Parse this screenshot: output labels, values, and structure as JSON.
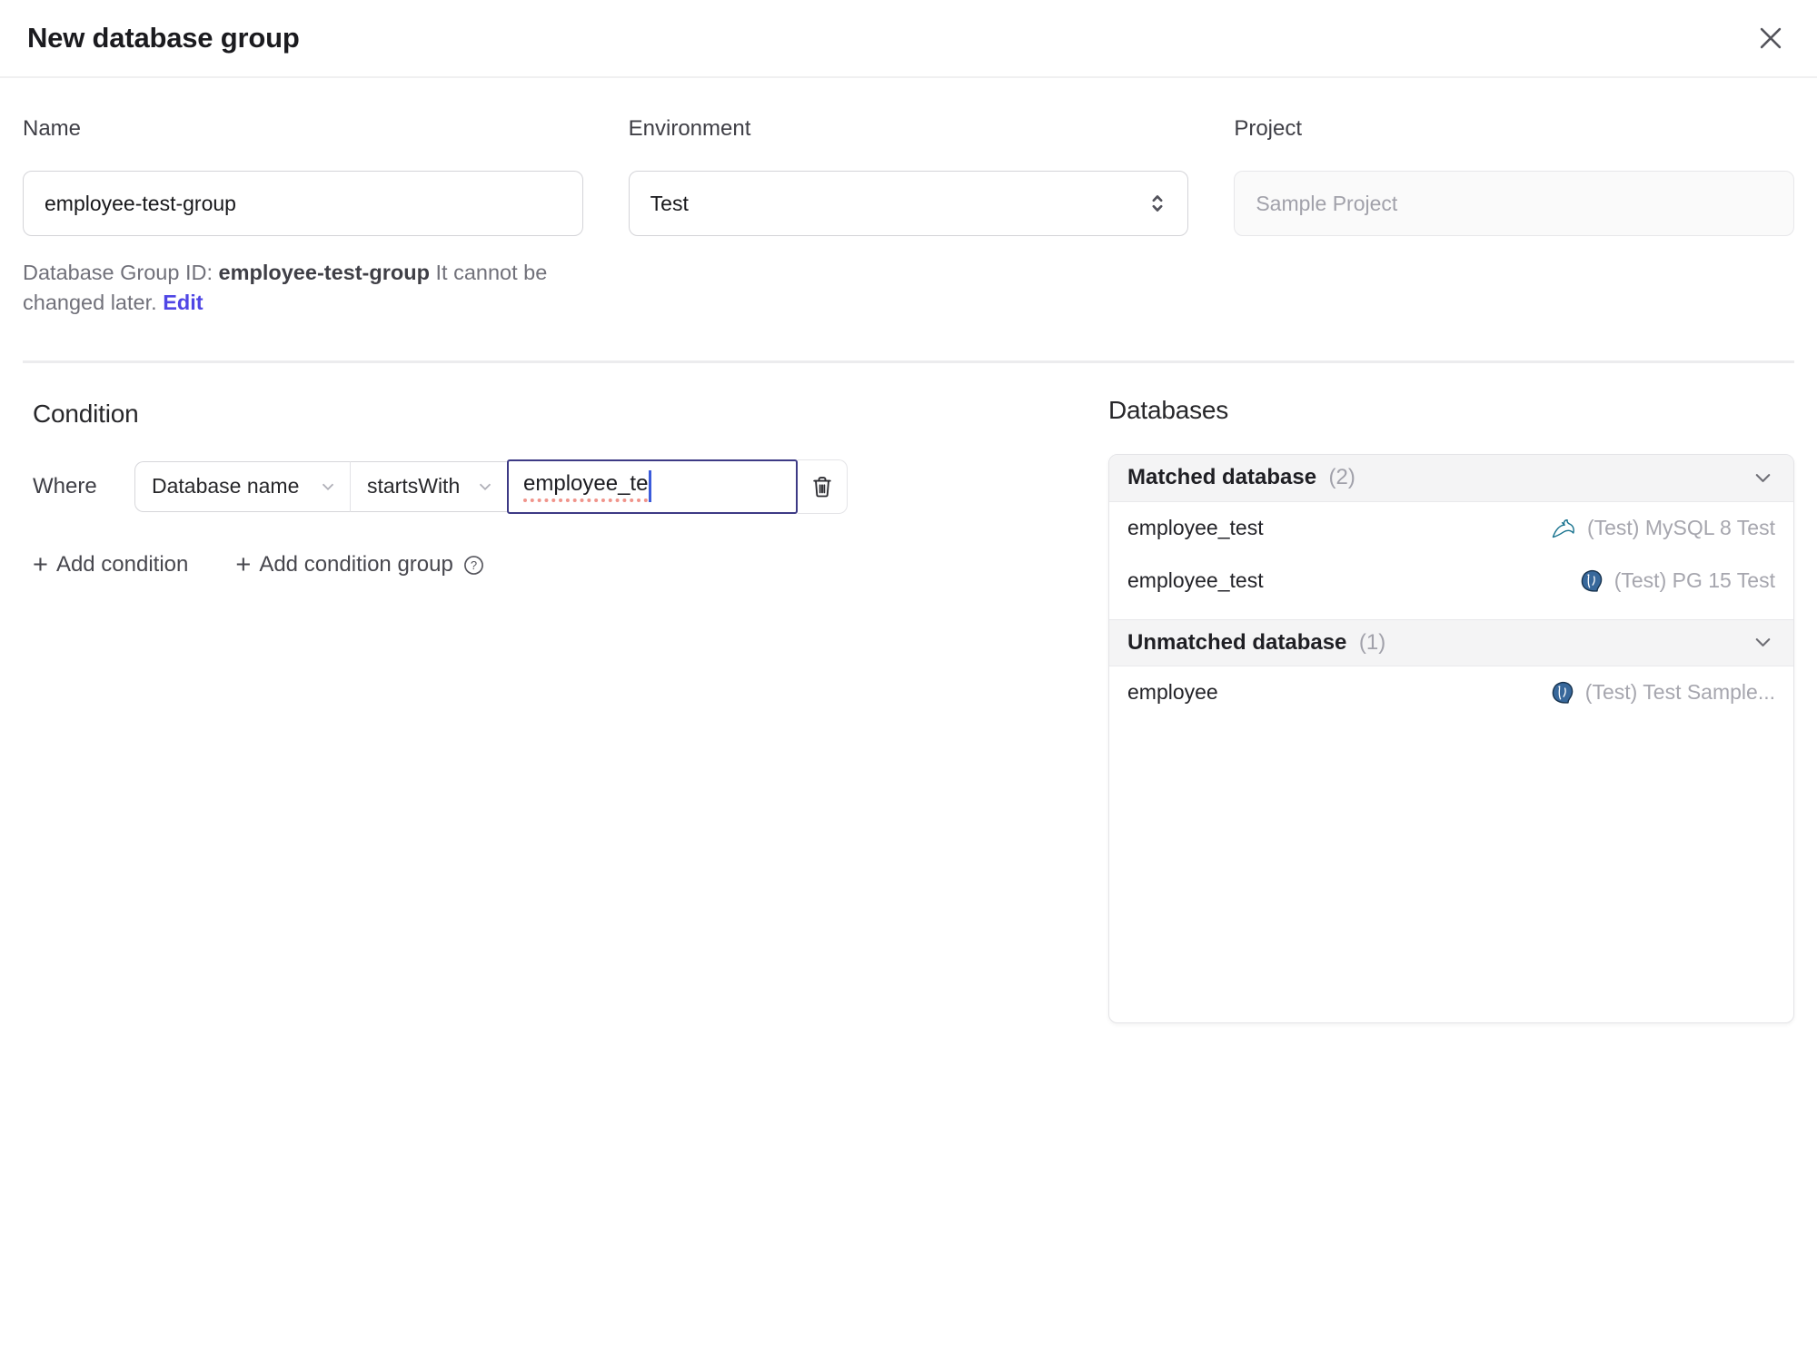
{
  "dialog": {
    "title": "New database group"
  },
  "form": {
    "name": {
      "label": "Name",
      "value": "employee-test-group"
    },
    "environment": {
      "label": "Environment",
      "value": "Test"
    },
    "project": {
      "label": "Project",
      "value": "Sample Project"
    },
    "helper": {
      "prefix": "Database Group ID:",
      "id": "employee-test-group",
      "suffix": "It cannot be changed later.",
      "edit": "Edit"
    }
  },
  "condition": {
    "heading": "Condition",
    "where": "Where",
    "field": "Database name",
    "operator": "startsWith",
    "value": "employee_te",
    "plus": "+",
    "add_condition": "Add condition",
    "add_condition_group": "Add condition group",
    "help_glyph": "?"
  },
  "databases": {
    "heading": "Databases",
    "sections": [
      {
        "title": "Matched database",
        "count": "(2)",
        "rows": [
          {
            "name": "employee_test",
            "engine": "mysql",
            "instance": "(Test) MySQL 8 Test"
          },
          {
            "name": "employee_test",
            "engine": "postgres",
            "instance": "(Test) PG 15 Test"
          }
        ]
      },
      {
        "title": "Unmatched database",
        "count": "(1)",
        "rows": [
          {
            "name": "employee",
            "engine": "postgres",
            "instance": "(Test) Test Sample..."
          }
        ]
      }
    ]
  },
  "colors": {
    "accent": "#4f46e5",
    "focus_border": "#3d3a85",
    "caret": "#3b5bdb",
    "squiggle": "#f0948b",
    "mysql": "#17728e",
    "postgres": "#38689b",
    "section_header_bg": "#f4f4f5"
  }
}
